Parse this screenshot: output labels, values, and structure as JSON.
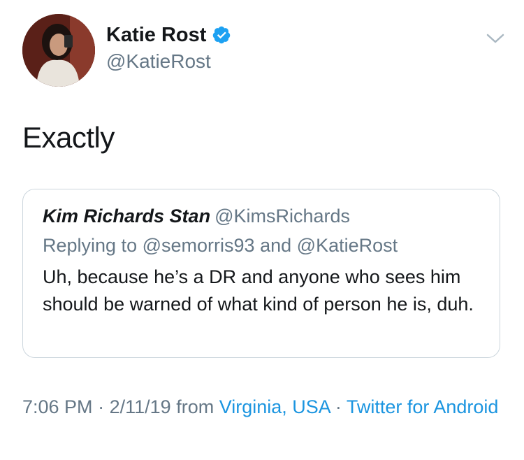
{
  "author": {
    "display_name": "Katie Rost",
    "handle": "@KatieRost",
    "verified": true,
    "avatar_icon": "profile-photo"
  },
  "tweet": {
    "text": "Exactly"
  },
  "quoted_tweet": {
    "display_name": "Kim Richards Stan",
    "handle": "@KimsRichards",
    "replying_to_prefix": "Replying to",
    "replying_to_users": [
      "@semorris93",
      "@KatieRost"
    ],
    "replying_to_joiner": "and",
    "text": "Uh, because he’s a DR and anyone who sees him should be warned of what kind of person he is, duh."
  },
  "meta": {
    "time": "7:06 PM",
    "separator": "·",
    "date": "2/11/19",
    "from_label": "from",
    "location": "Virginia, USA",
    "source": "Twitter for Android"
  },
  "colors": {
    "primary_text": "#14171a",
    "secondary_text": "#657786",
    "link": "#1b95e0",
    "verified_badge": "#1da1f2",
    "card_border": "#ccd6dd"
  },
  "icons": {
    "verified": "verified-badge-icon",
    "menu": "chevron-down-icon"
  }
}
